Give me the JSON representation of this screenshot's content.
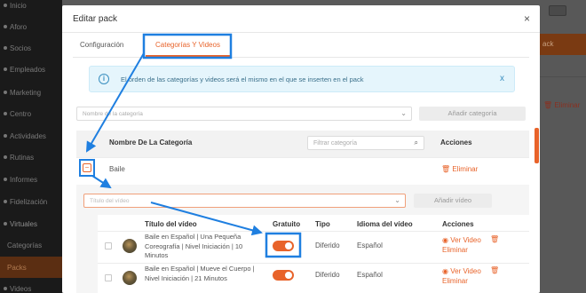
{
  "sidebar": {
    "items": [
      {
        "label": "Inicio",
        "kind": "item"
      },
      {
        "label": "Aforo",
        "kind": "item"
      },
      {
        "label": "Socios",
        "kind": "item"
      },
      {
        "label": "Empleados",
        "kind": "item"
      },
      {
        "label": "Marketing",
        "kind": "item"
      },
      {
        "label": "Centro",
        "kind": "item"
      },
      {
        "label": "Actividades",
        "kind": "item"
      },
      {
        "label": "Rutinas",
        "kind": "item"
      },
      {
        "label": "Informes",
        "kind": "item"
      },
      {
        "label": "Fidelización",
        "kind": "item"
      },
      {
        "label": "Virtuales",
        "kind": "section"
      },
      {
        "label": "Categorías",
        "kind": "sub"
      },
      {
        "label": "Packs",
        "kind": "active"
      },
      {
        "label": "Videos",
        "kind": "item"
      }
    ]
  },
  "background": {
    "button_label": "ack",
    "eliminar_label": "Eliminar"
  },
  "modal": {
    "title": "Editar pack",
    "close_glyph": "×",
    "tabs": [
      {
        "label": "Configuración"
      },
      {
        "label": "Categorías Y Videos",
        "active": true
      }
    ],
    "info": {
      "icon_glyph": "i",
      "text": "El orden de las categorías y videos será el mismo en el que se inserten en el pack",
      "close_glyph": "x"
    },
    "category_select": {
      "placeholder": "Nombre de la categoría"
    },
    "add_category_button": "Añadir categoría",
    "table": {
      "header_name": "Nombre De La Categoría",
      "filter_placeholder": "Filtrar categoría",
      "header_actions": "Acciones"
    },
    "category_row": {
      "name": "Baile",
      "delete_label": "Eliminar"
    },
    "video_select": {
      "placeholder": "Título del vídeo"
    },
    "add_video_button": "Añadir vídeo",
    "video_table": {
      "headers": {
        "title": "Título del vídeo",
        "free": "Gratuito",
        "type": "Tipo",
        "language": "Idioma del vídeo",
        "actions": "Acciones"
      },
      "rows": [
        {
          "title": "Baile en Español | Una Pequeña Coreografía | Nivel Iniciación | 10 Minutos",
          "free": true,
          "type": "Diferido",
          "language": "Español",
          "view_label": "Ver Video",
          "delete_label": "Eliminar"
        },
        {
          "title": "Baile en Español | Mueve el Cuerpo | Nivel Iniciación | 21 Minutos",
          "free": true,
          "type": "Diferido",
          "language": "Español",
          "view_label": "Ver Video",
          "delete_label": "Eliminar"
        }
      ]
    }
  },
  "icons": {
    "search": "search-icon",
    "chevron": "chevron-down-icon",
    "trash": "trash-icon",
    "eye": "eye-icon",
    "info": "info-icon",
    "close": "close-icon"
  },
  "colors": {
    "accent": "#e8632a",
    "annotation": "#1f7fe0",
    "info_bg": "#e5f5fc"
  }
}
